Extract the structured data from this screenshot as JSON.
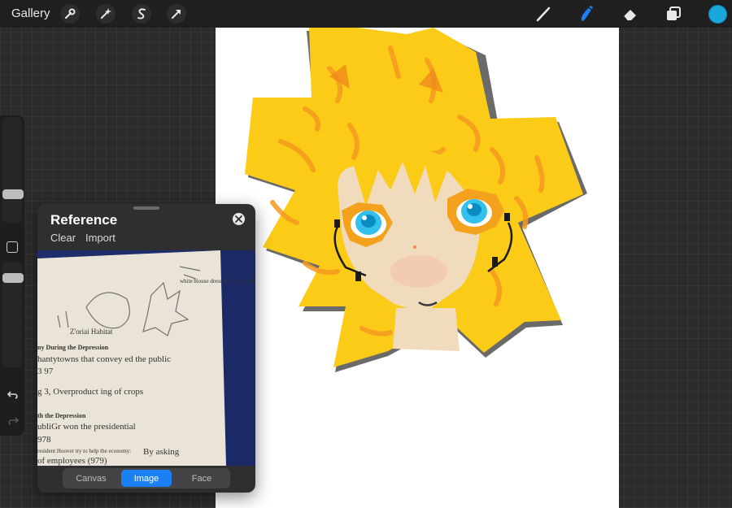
{
  "topbar": {
    "gallery_label": "Gallery",
    "left_tools": [
      "wrench-icon",
      "magic-wand-icon",
      "selection-icon",
      "transform-arrow-icon"
    ],
    "right_tools": [
      "brush-icon",
      "smudge-icon",
      "eraser-icon",
      "layers-icon"
    ],
    "active_tool": "smudge-icon",
    "accent_color": "#1b80f6",
    "current_color": "#1aa7dc"
  },
  "sidebar": {
    "size_slider_level": 0.75,
    "opacity_slider_level": 0.55,
    "icons": [
      "modify-square-icon",
      "undo-icon",
      "redo-icon"
    ]
  },
  "reference": {
    "title": "Reference",
    "clear_label": "Clear",
    "import_label": "Import",
    "photo_texts": {
      "p1": "Z'oriai\nHabitat",
      "p2": "ny During the Depression",
      "p3": "hantytowns that convey ed the public",
      "p4": "3 97",
      "p5": "g 3, Overproduct ing of crops",
      "p6": "th the Depression",
      "p7": "ubliGr won the presidential",
      "p8": "978",
      "p9": "resident Hoover try to help the economy:",
      "p10": "By asking",
      "p11": "of employees (979)",
      "p12": "white blouse\ndress\nshirt\nskirt\nwith\nbaggy\njeans"
    },
    "tabs": [
      {
        "label": "Canvas",
        "active": false
      },
      {
        "label": "Image",
        "active": true
      },
      {
        "label": "Face",
        "active": false
      }
    ]
  }
}
